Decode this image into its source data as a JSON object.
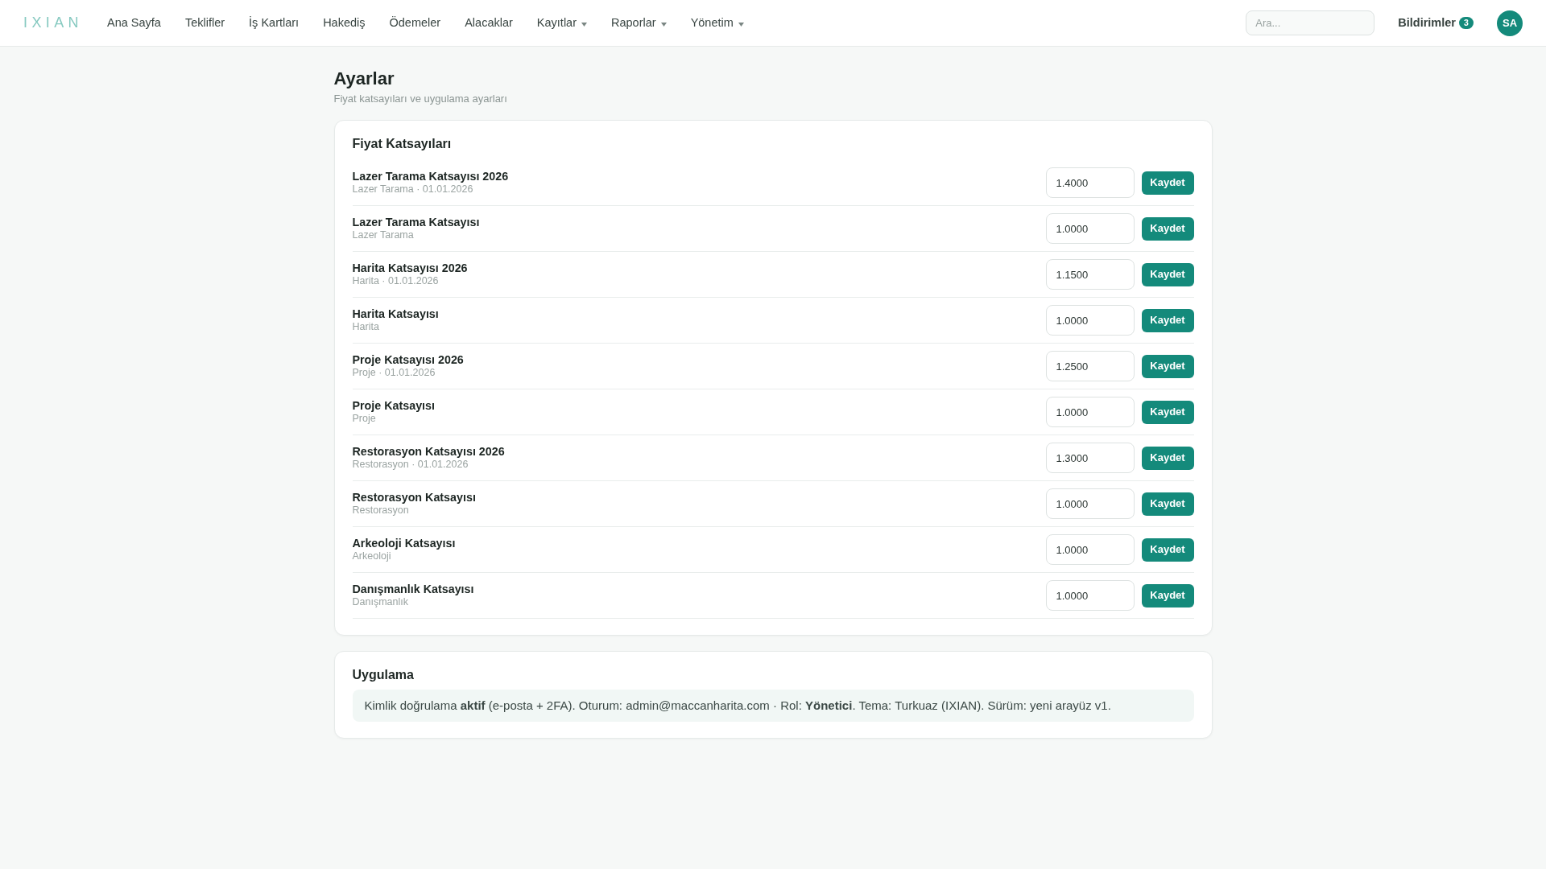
{
  "nav": {
    "logo": "IXIAN",
    "items": [
      {
        "label": "Ana Sayfa",
        "dropdown": false
      },
      {
        "label": "Teklifler",
        "dropdown": false
      },
      {
        "label": "İş Kartları",
        "dropdown": false
      },
      {
        "label": "Hakediş",
        "dropdown": false
      },
      {
        "label": "Ödemeler",
        "dropdown": false
      },
      {
        "label": "Alacaklar",
        "dropdown": false
      },
      {
        "label": "Kayıtlar",
        "dropdown": true
      },
      {
        "label": "Raporlar",
        "dropdown": true
      },
      {
        "label": "Yönetim",
        "dropdown": true
      }
    ],
    "search": {
      "placeholder": "Ara..."
    },
    "notifications": {
      "label": "Bildirimler",
      "count": "3"
    },
    "avatar": "SA"
  },
  "page": {
    "title": "Ayarlar",
    "subtitle": "Fiyat katsayıları ve uygulama ayarları"
  },
  "price_coefficients": {
    "title": "Fiyat Katsayıları",
    "rows": [
      {
        "name": "Lazer Tarama Katsayısı 2026",
        "detail": "Lazer Tarama · 01.01.2026",
        "value": "1.4000",
        "button": "Kaydet"
      },
      {
        "name": "Lazer Tarama Katsayısı",
        "detail": "Lazer Tarama",
        "value": "1.0000",
        "button": "Kaydet"
      },
      {
        "name": "Harita Katsayısı 2026",
        "detail": "Harita · 01.01.2026",
        "value": "1.1500",
        "button": "Kaydet"
      },
      {
        "name": "Harita Katsayısı",
        "detail": "Harita",
        "value": "1.0000",
        "button": "Kaydet"
      },
      {
        "name": "Proje Katsayısı 2026",
        "detail": "Proje · 01.01.2026",
        "value": "1.2500",
        "button": "Kaydet"
      },
      {
        "name": "Proje Katsayısı",
        "detail": "Proje",
        "value": "1.0000",
        "button": "Kaydet"
      },
      {
        "name": "Restorasyon Katsayısı 2026",
        "detail": "Restorasyon · 01.01.2026",
        "value": "1.3000",
        "button": "Kaydet"
      },
      {
        "name": "Restorasyon Katsayısı",
        "detail": "Restorasyon",
        "value": "1.0000",
        "button": "Kaydet"
      },
      {
        "name": "Arkeoloji Katsayısı",
        "detail": "Arkeoloji",
        "value": "1.0000",
        "button": "Kaydet"
      },
      {
        "name": "Danışmanlık Katsayısı",
        "detail": "Danışmanlık",
        "value": "1.0000",
        "button": "Kaydet"
      }
    ]
  },
  "application": {
    "title": "Uygulama",
    "info": "Kimlik doğrulama **aktif** (e-posta + 2FA). Oturum: admin@maccanharita.com · Rol: **Yönetici**. Tema: Turkuaz (IXIAN). Sürüm: yeni arayüz v1."
  }
}
